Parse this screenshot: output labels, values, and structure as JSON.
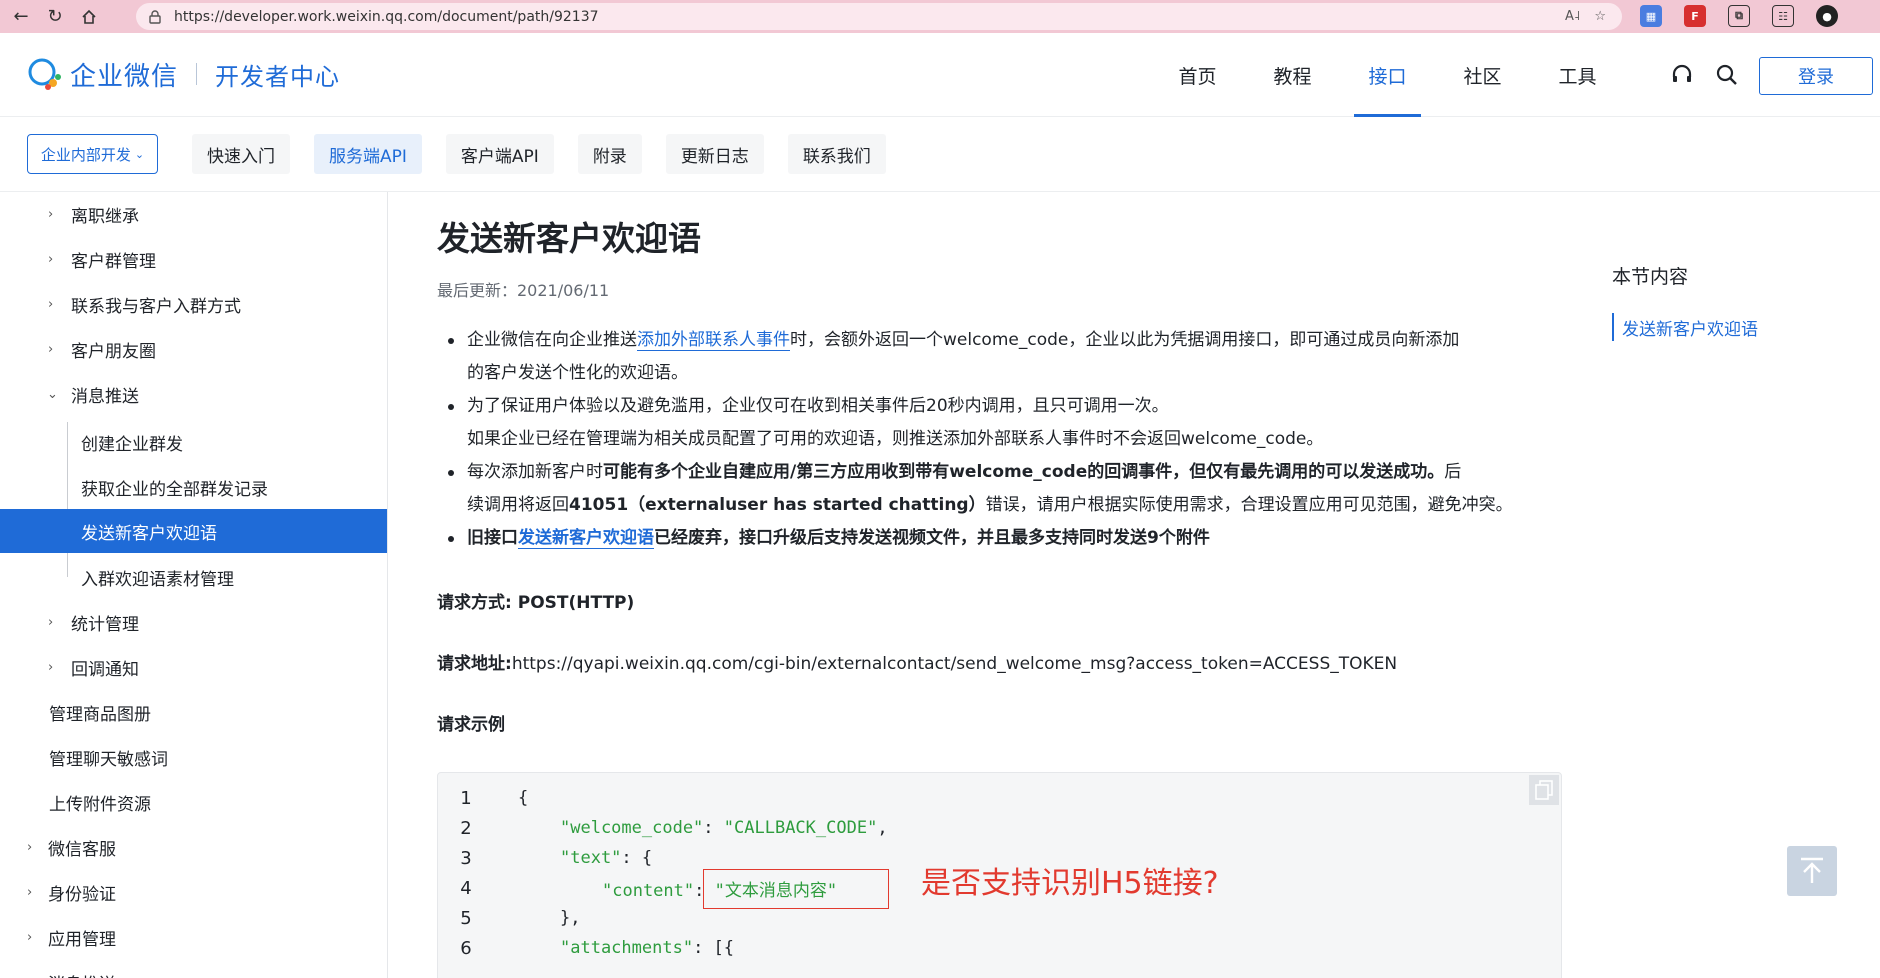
{
  "browser": {
    "url": "https://developer.work.weixin.qq.com/document/path/92137"
  },
  "header": {
    "logo_text": "企业微信",
    "logo_sub": "开发者中心",
    "nav": [
      "首页",
      "教程",
      "接口",
      "社区",
      "工具"
    ],
    "active_nav": "接口",
    "login": "登录"
  },
  "subnav": {
    "scope": "企业内部开发",
    "tabs": [
      "快速入门",
      "服务端API",
      "客户端API",
      "附录",
      "更新日志",
      "联系我们"
    ],
    "active_tab": "服务端API"
  },
  "sidebar": {
    "items": [
      "离职继承",
      "客户群管理",
      "联系我与客户入群方式",
      "客户朋友圈",
      "消息推送",
      "创建企业群发",
      "获取企业的全部群发记录",
      "发送新客户欢迎语",
      "入群欢迎语素材管理",
      "统计管理",
      "回调通知",
      "管理商品图册",
      "管理聊天敏感词",
      "上传附件资源",
      "微信客服",
      "身份验证",
      "应用管理",
      "消息推送"
    ],
    "active": "发送新客户欢迎语"
  },
  "doc": {
    "title": "发送新客户欢迎语",
    "updated": "最后更新：2021/06/11",
    "b1_pre": "企业微信在向企业推送",
    "b1_link": "添加外部联系人事件",
    "b1_post": "时，会额外返回一个welcome_code，企业以此为凭据调用接口，即可通过成员向新添加",
    "b1_line2": "的客户发送个性化的欢迎语。",
    "b2_line1": "为了保证用户体验以及避免滥用，企业仅可在收到相关事件后20秒内调用，且只可调用一次。",
    "b2_line2": "如果企业已经在管理端为相关成员配置了可用的欢迎语，则推送添加外部联系人事件时不会返回welcome_code。",
    "b3_pre": "每次添加新客户时",
    "b3_bold": "可能有多个企业自建应用/第三方应用收到带有welcome_code的回调事件，但仅有最先调用的可以发送成功。",
    "b3_post": "后",
    "b3_line2_pre": "续调用将返回",
    "b3_line2_bold": "41051（externaluser has started chatting）",
    "b3_line2_post": "错误，请用户根据实际使用需求，合理设置应用可见范围，避免冲突。",
    "b4_pre": "旧接口",
    "b4_link": "发送新客户欢迎语",
    "b4_post": "已经废弃，接口升级后支持发送视频文件，并且最多支持同时发送9个附件",
    "method_label": "请求方式:",
    "method_value": " POST(HTTP)",
    "url_label": "请求地址:",
    "url_value": "https://qyapi.weixin.qq.com/cgi-bin/externalcontact/send_welcome_msg?access_token=ACCESS_TOKEN",
    "example_label": "请求示例"
  },
  "code": {
    "line_numbers": [
      "1",
      "2",
      "3",
      "4",
      "5",
      "6"
    ],
    "l1": "{",
    "l2_key": "\"welcome_code\"",
    "l2_sep": ": ",
    "l2_val": "\"CALLBACK_CODE\"",
    "l2_end": ",",
    "l3_key": "\"text\"",
    "l3_end": ": {",
    "l4_key": "\"content\"",
    "l4_sep": ": ",
    "l4_val": "\"文本消息内容\"",
    "l5": "},",
    "l6_key": "\"attachments\"",
    "l6_end": ": [{"
  },
  "annotation": {
    "note": "是否支持识别H5链接?"
  },
  "toc": {
    "title": "本节内容",
    "link": "发送新客户欢迎语"
  }
}
